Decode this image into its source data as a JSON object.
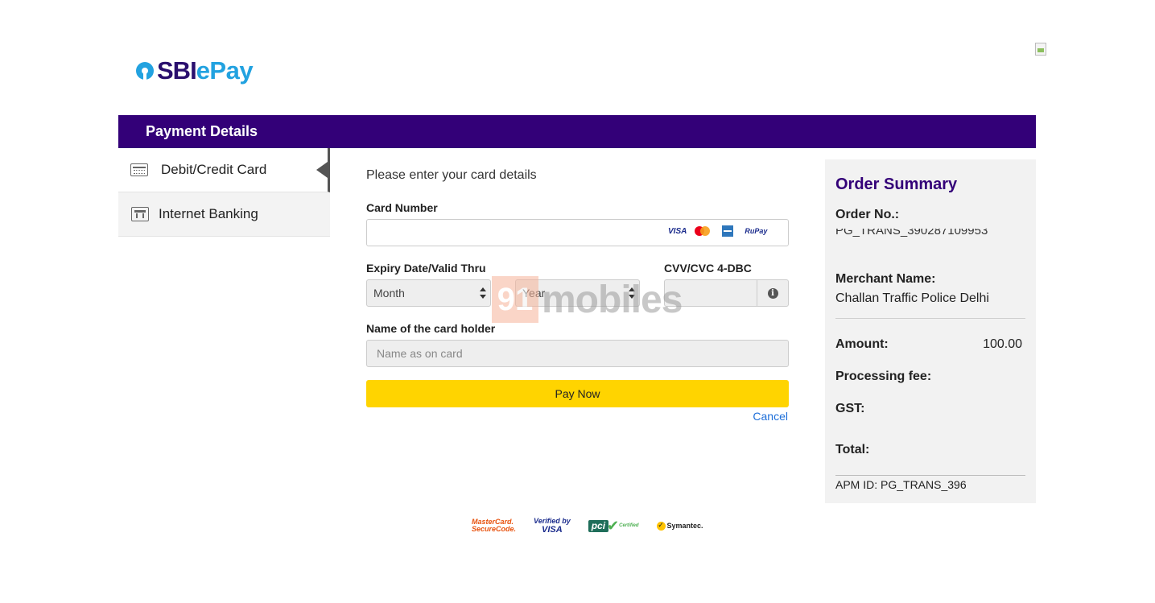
{
  "brand": {
    "logo_sbi": "SBI",
    "logo_epay": "ePay"
  },
  "header": {
    "title": "Payment Details"
  },
  "nav": {
    "items": [
      {
        "label": "Debit/Credit Card",
        "icon": "credit-card-icon",
        "active": true
      },
      {
        "label": "Internet Banking",
        "icon": "bank-icon",
        "active": false
      }
    ]
  },
  "form": {
    "instructions": "Please enter your card details",
    "card_number_label": "Card Number",
    "card_number_value": "",
    "card_brands": [
      "VISA",
      "MasterCard",
      "AmEx",
      "RuPay"
    ],
    "expiry_label": "Expiry Date/Valid Thru",
    "month_value": "Month",
    "year_value": "Year",
    "cvv_label": "CVV/CVC 4-DBC",
    "cvv_value": "",
    "holder_label": "Name of the card holder",
    "holder_placeholder": "Name as on card",
    "pay_label": "Pay Now",
    "cancel_label": "Cancel"
  },
  "watermark": {
    "box": "91",
    "text": "mobiles"
  },
  "summary": {
    "title": "Order Summary",
    "order_no_label": "Order No.:",
    "order_no_value": "PG_TRANS_390287109953",
    "merchant_label": "Merchant Name:",
    "merchant_value": "Challan Traffic Police Delhi",
    "amount_label": "Amount:",
    "amount_value": "100.00",
    "fee_label": "Processing fee:",
    "gst_label": "GST:",
    "total_label": "Total:",
    "apm_id": "APM ID: PG_TRANS_396"
  },
  "badges": {
    "mastercard_line1": "MasterCard.",
    "mastercard_line2": "SecureCode.",
    "visa_line1": "Verified by",
    "visa_line2": "VISA",
    "pci_text": "pci",
    "pci_sub": "Certified",
    "symantec": "Symantec."
  },
  "colors": {
    "header": "#330078",
    "accent": "#22a2e0",
    "pay_button": "#ffd400",
    "link": "#1e6fd9"
  }
}
